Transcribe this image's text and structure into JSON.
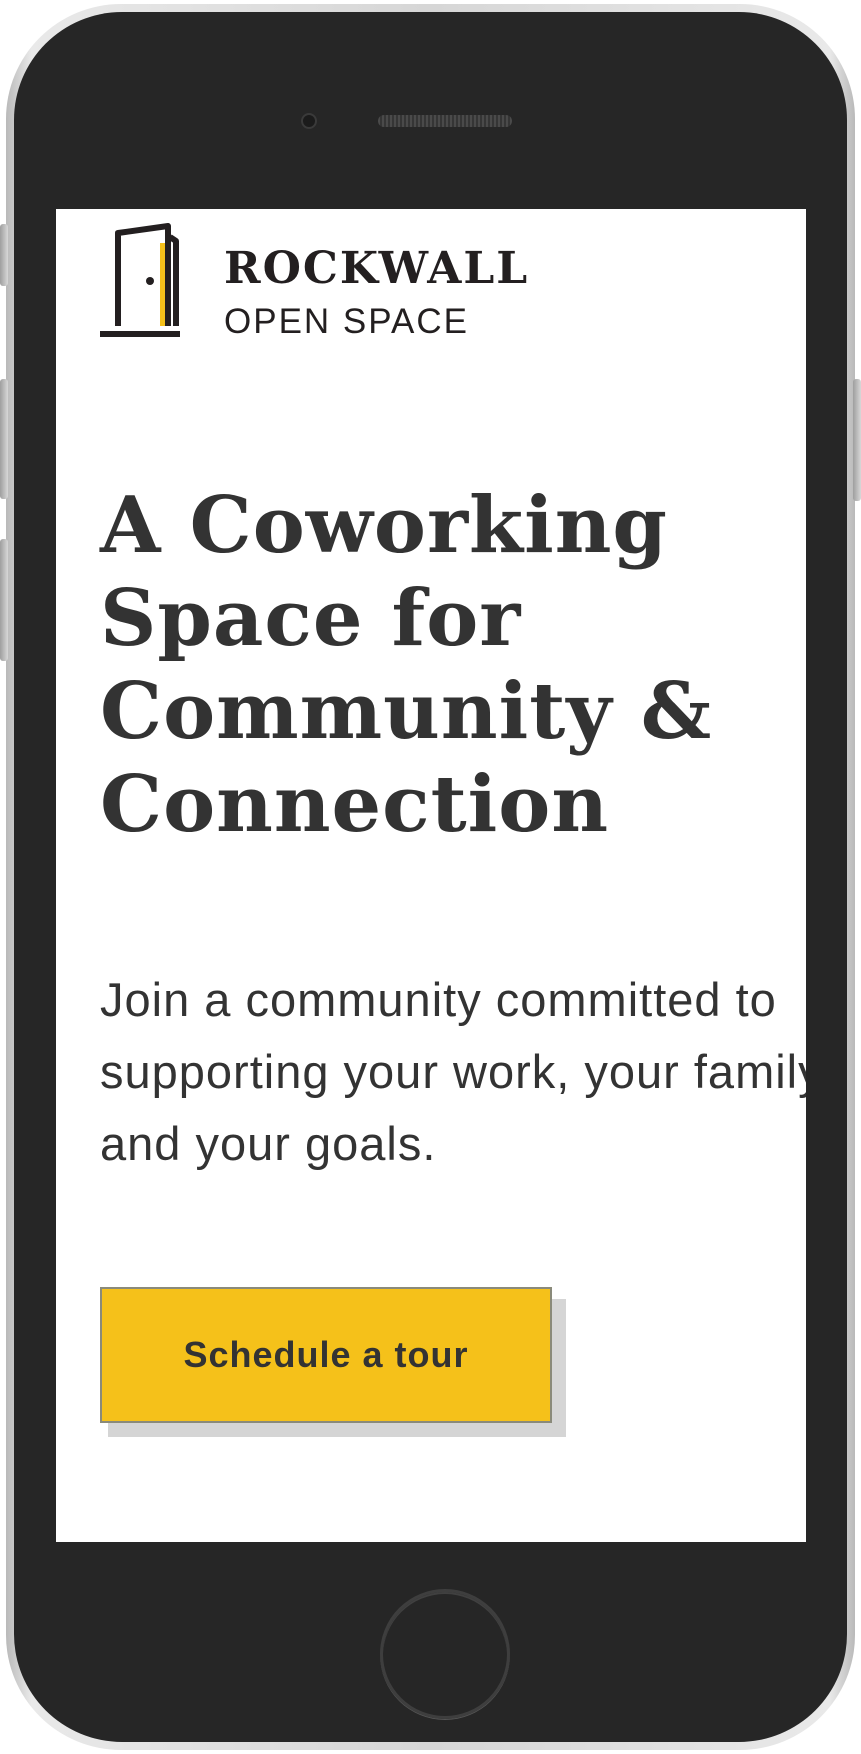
{
  "logo": {
    "title": "ROCKWALL",
    "subtitle": "OPEN SPACE",
    "icon": "door-icon",
    "accent_color": "#f5c11a"
  },
  "hero": {
    "headline_lines": [
      "A Coworking",
      "Space for",
      "Community &",
      "Connection"
    ],
    "intro_lines": [
      "Join a community committed to",
      "supporting your work, your family",
      "and your goals."
    ],
    "cta_label": "Schedule a tour"
  },
  "colors": {
    "text": "#333333",
    "button": "#f5c11a",
    "device_body": "#262626"
  }
}
